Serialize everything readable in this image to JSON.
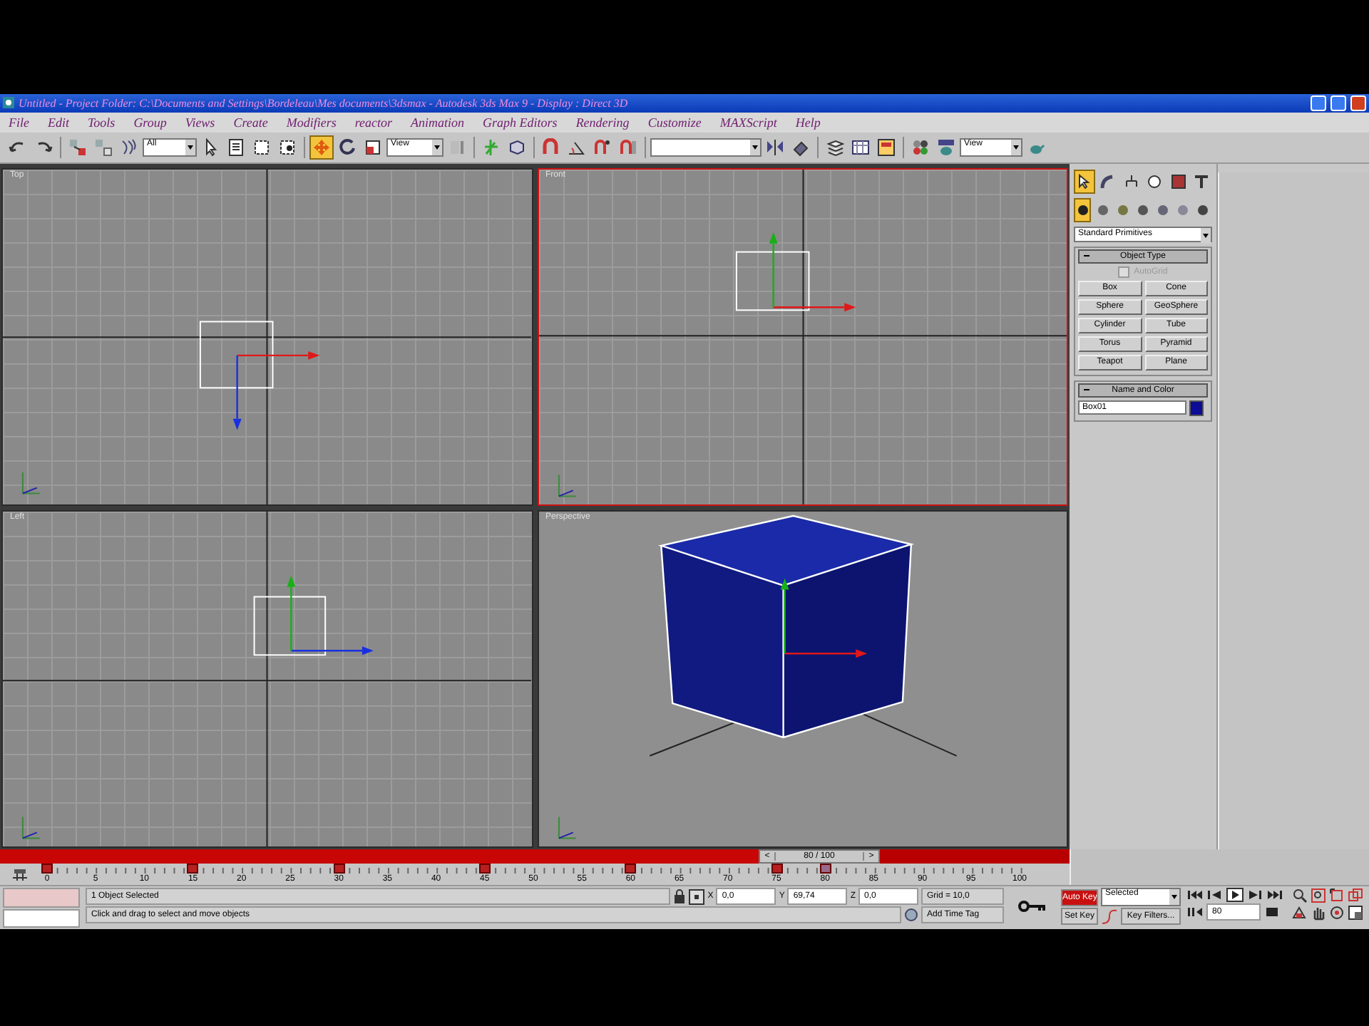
{
  "window": {
    "title": "Untitled   - Project Folder: C:\\Documents and Settings\\Bordeleau\\Mes documents\\3dsmax   - Autodesk 3ds Max 9   - Display : Direct 3D"
  },
  "menu": [
    "File",
    "Edit",
    "Tools",
    "Group",
    "Views",
    "Create",
    "Modifiers",
    "reactor",
    "Animation",
    "Graph Editors",
    "Rendering",
    "Customize",
    "MAXScript",
    "Help"
  ],
  "toolbar": {
    "dropdowns": [
      "All",
      "View",
      "View"
    ],
    "transform_tools": [
      {
        "selected": true
      },
      {
        "selected": false
      },
      {
        "selected": false
      }
    ]
  },
  "viewports": [
    {
      "label": "Top",
      "kind": "top",
      "active": false
    },
    {
      "label": "Front",
      "kind": "front",
      "active": true
    },
    {
      "label": "Left",
      "kind": "left",
      "active": false
    },
    {
      "label": "Perspective",
      "kind": "perspective",
      "active": false
    }
  ],
  "command_panel": {
    "tabs": [
      {
        "selected": true
      },
      {
        "selected": false
      },
      {
        "selected": false
      },
      {
        "selected": false
      },
      {
        "selected": false
      },
      {
        "selected": false
      }
    ],
    "categories": [
      {
        "selected": true
      },
      {
        "selected": false
      },
      {
        "selected": false
      },
      {
        "selected": false
      },
      {
        "selected": false
      },
      {
        "selected": false
      },
      {
        "selected": false
      }
    ],
    "subcategory": "Standard Primitives",
    "object_type": {
      "title": "Object Type",
      "autogrid": {
        "label": "AutoGrid",
        "checked": false,
        "disabled": true
      },
      "buttons": [
        "Box",
        "Cone",
        "Sphere",
        "GeoSphere",
        "Cylinder",
        "Tube",
        "Torus",
        "Pyramid",
        "Teapot",
        "Plane"
      ]
    },
    "name_and_color": {
      "title": "Name and Color",
      "name": "Box01",
      "color": "#0c0c96"
    }
  },
  "time_slider": {
    "label": "80 / 100",
    "level": 0.8,
    "prev": "<",
    "next": ">"
  },
  "timeline": {
    "ticks": [
      {
        "label": "0",
        "key": true
      },
      {
        "label": "5",
        "key": false
      },
      {
        "label": "10",
        "key": false
      },
      {
        "label": "15",
        "key": true
      },
      {
        "label": "20",
        "key": false
      },
      {
        "label": "25",
        "key": false
      },
      {
        "label": "30",
        "key": true
      },
      {
        "label": "35",
        "key": false
      },
      {
        "label": "40",
        "key": false
      },
      {
        "label": "45",
        "key": true
      },
      {
        "label": "50",
        "key": false
      },
      {
        "label": "55",
        "key": false
      },
      {
        "label": "60",
        "key": true
      },
      {
        "label": "65",
        "key": false
      },
      {
        "label": "70",
        "key": false
      },
      {
        "label": "75",
        "key": true
      },
      {
        "label": "80",
        "key": false
      },
      {
        "label": "85",
        "key": false
      },
      {
        "label": "90",
        "key": false
      },
      {
        "label": "95",
        "key": false
      },
      {
        "label": "100",
        "key": false
      }
    ]
  },
  "status": {
    "selection": "1 Object Selected",
    "prompt": "Click and drag to select and move objects",
    "coords": [
      {
        "axis": "X",
        "value": "0,0"
      },
      {
        "axis": "Y",
        "value": "69,74"
      },
      {
        "axis": "Z",
        "value": "0,0"
      }
    ],
    "grid": "Grid = 10,0",
    "time_tag": "Add Time Tag",
    "auto_key": {
      "label": "Auto Key",
      "on": true
    },
    "key_mode": "Selected",
    "set_key": "Set Key",
    "key_filters": "Key Filters...",
    "frame": "80"
  }
}
